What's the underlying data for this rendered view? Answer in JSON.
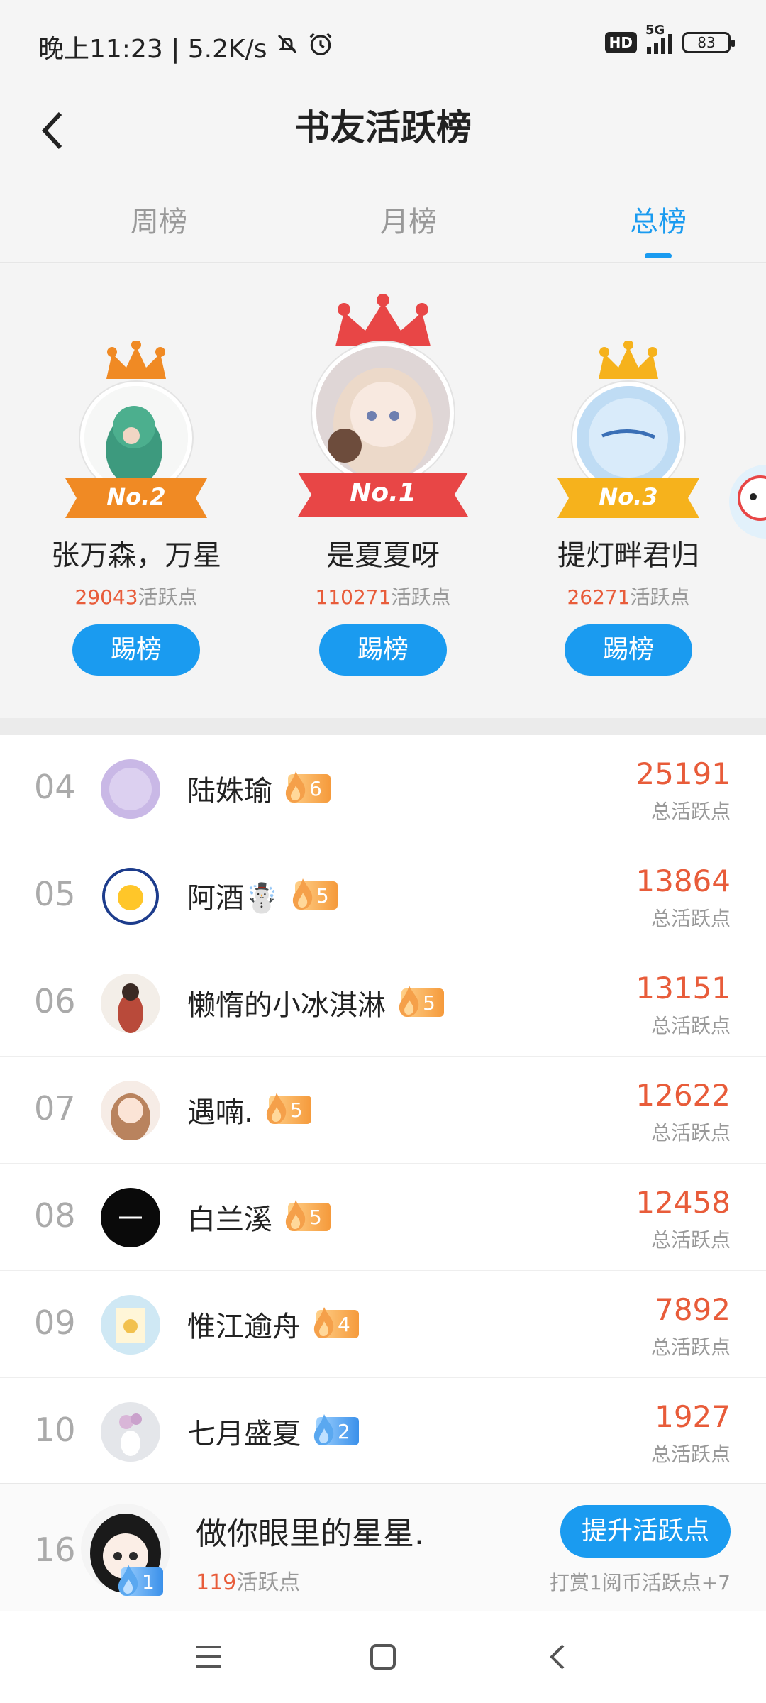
{
  "status_bar": {
    "time_speed": "晚上11:23 | 5.2K/s",
    "hd": "HD",
    "network": "5G",
    "battery": "83"
  },
  "header": {
    "title": "书友活跃榜"
  },
  "tabs": [
    {
      "label": "周榜",
      "active": false
    },
    {
      "label": "月榜",
      "active": false
    },
    {
      "label": "总榜",
      "active": true
    }
  ],
  "podium": {
    "points_suffix": "活跃点",
    "kick_label": "踢榜",
    "first": {
      "badge": "No.1",
      "name": "是夏夏呀",
      "points": "110271",
      "color": "#e84646"
    },
    "second": {
      "badge": "No.2",
      "name": "张万森，万星",
      "points": "29043",
      "color": "#f08a24"
    },
    "third": {
      "badge": "No.3",
      "name": "提灯畔君归",
      "points": "26271",
      "color": "#f6b21c"
    }
  },
  "list": {
    "score_label": "总活跃点",
    "rows": [
      {
        "rank": "04",
        "name": "陆姝瑜",
        "level": "6",
        "score": "25191",
        "level_color": "orange"
      },
      {
        "rank": "05",
        "name": "阿酒☃️",
        "level": "5",
        "score": "13864",
        "level_color": "orange"
      },
      {
        "rank": "06",
        "name": "懒惰的小冰淇淋",
        "level": "5",
        "score": "13151",
        "level_color": "orange"
      },
      {
        "rank": "07",
        "name": "遇喃.",
        "level": "5",
        "score": "12622",
        "level_color": "orange"
      },
      {
        "rank": "08",
        "name": "白兰溪",
        "level": "5",
        "score": "12458",
        "level_color": "orange"
      },
      {
        "rank": "09",
        "name": "惟江逾舟",
        "level": "4",
        "score": "7892",
        "level_color": "orange"
      },
      {
        "rank": "10",
        "name": "七月盛夏",
        "level": "2",
        "score": "1927",
        "level_color": "blue"
      }
    ]
  },
  "my_rank": {
    "rank": "16",
    "name": "做你眼里的星星.",
    "level": "1",
    "points": "119",
    "points_suffix": "活跃点",
    "boost_label": "提升活跃点",
    "tip": "打赏1阅币活跃点+7"
  },
  "colors": {
    "accent": "#1a9bf0",
    "score": "#e85c3a"
  }
}
